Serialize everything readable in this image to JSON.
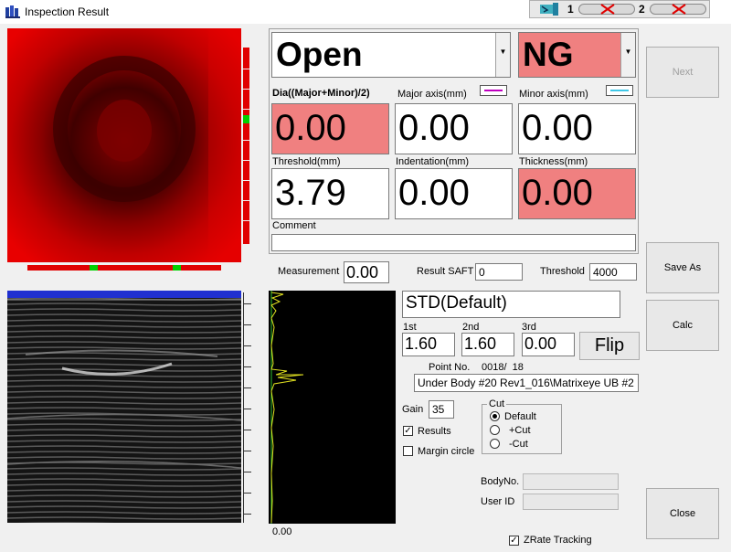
{
  "window": {
    "title": "Inspection Result"
  },
  "channels": [
    {
      "num": "1"
    },
    {
      "num": "2"
    }
  ],
  "status": {
    "open_value": "Open",
    "ng_value": "NG"
  },
  "labels": {
    "dia": "Dia((Major+Minor)/2)",
    "major": "Major axis(mm)",
    "minor": "Minor axis(mm)",
    "threshold": "Threshold(mm)",
    "indentation": "Indentation(mm)",
    "thickness": "Thickness(mm)",
    "comment": "Comment",
    "measurement": "Measurement",
    "result_saft": "Result SAFT",
    "threshold_small": "Threshold",
    "first": "1st",
    "second": "2nd",
    "third": "3rd",
    "point_no": "Point No.",
    "gain": "Gain",
    "cut": "Cut",
    "body_no": "BodyNo.",
    "user_id": "User ID"
  },
  "values": {
    "dia": "0.00",
    "major": "0.00",
    "minor": "0.00",
    "threshold": "3.79",
    "indentation": "0.00",
    "thickness": "0.00",
    "comment": "",
    "measurement": "0.00",
    "result_saft": "0",
    "threshold_small": "4000",
    "probe": "STD(Default)",
    "first": "1.60",
    "second": "1.60",
    "third": "0.00",
    "point_no": "0018/  18",
    "file_path": "Under Body #20 Rev1_016\\Matrixeye UB #2",
    "gain": "35",
    "body_no": "",
    "user_id": "",
    "ascan_value": "0.00"
  },
  "buttons": {
    "next": "Next",
    "save_as": "Save As",
    "calc": "Calc",
    "close": "Close",
    "flip": "Flip"
  },
  "checkboxes": {
    "results": "Results",
    "margin_circle": "Margin circle",
    "zrate": "ZRate Tracking"
  },
  "radios": {
    "default": "Default",
    "plus_cut": "+Cut",
    "minus_cut": "-Cut"
  },
  "colors": {
    "major_legend": "#c000c0",
    "minor_legend": "#40c8e8",
    "ng_pink": "#f08080"
  }
}
